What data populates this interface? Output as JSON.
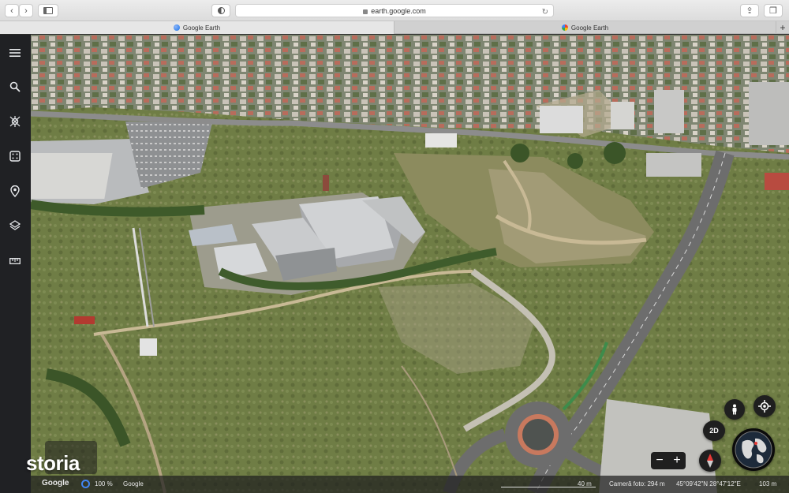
{
  "browser": {
    "url": "earth.google.com",
    "tabs": [
      {
        "label": "Google Earth",
        "active": true
      },
      {
        "label": "Google Earth",
        "active": false
      }
    ]
  },
  "sidebar": {
    "items": [
      {
        "icon": "menu-icon"
      },
      {
        "icon": "search-icon"
      },
      {
        "icon": "voyager-icon"
      },
      {
        "icon": "dice-icon"
      },
      {
        "icon": "location-pin-icon"
      },
      {
        "icon": "layers-icon"
      },
      {
        "icon": "ruler-icon"
      }
    ]
  },
  "controls": {
    "view_mode": "2D",
    "pegman_icon": "person-icon",
    "location_icon": "my-location-icon",
    "compass_icon": "compass-icon",
    "zoom_out": "−",
    "zoom_in": "+"
  },
  "status": {
    "google_logo": "Google",
    "progress": "100 %",
    "attribution": "Google",
    "scale": "40 m",
    "camera": "Cameră foto: 294 m",
    "coordinates": "45°09'42\"N 28°47'12\"E",
    "elevation": "103 m"
  },
  "watermark": "storia",
  "colors": {
    "sidebar_bg": "#202124",
    "accent_blue": "#4285f4"
  }
}
